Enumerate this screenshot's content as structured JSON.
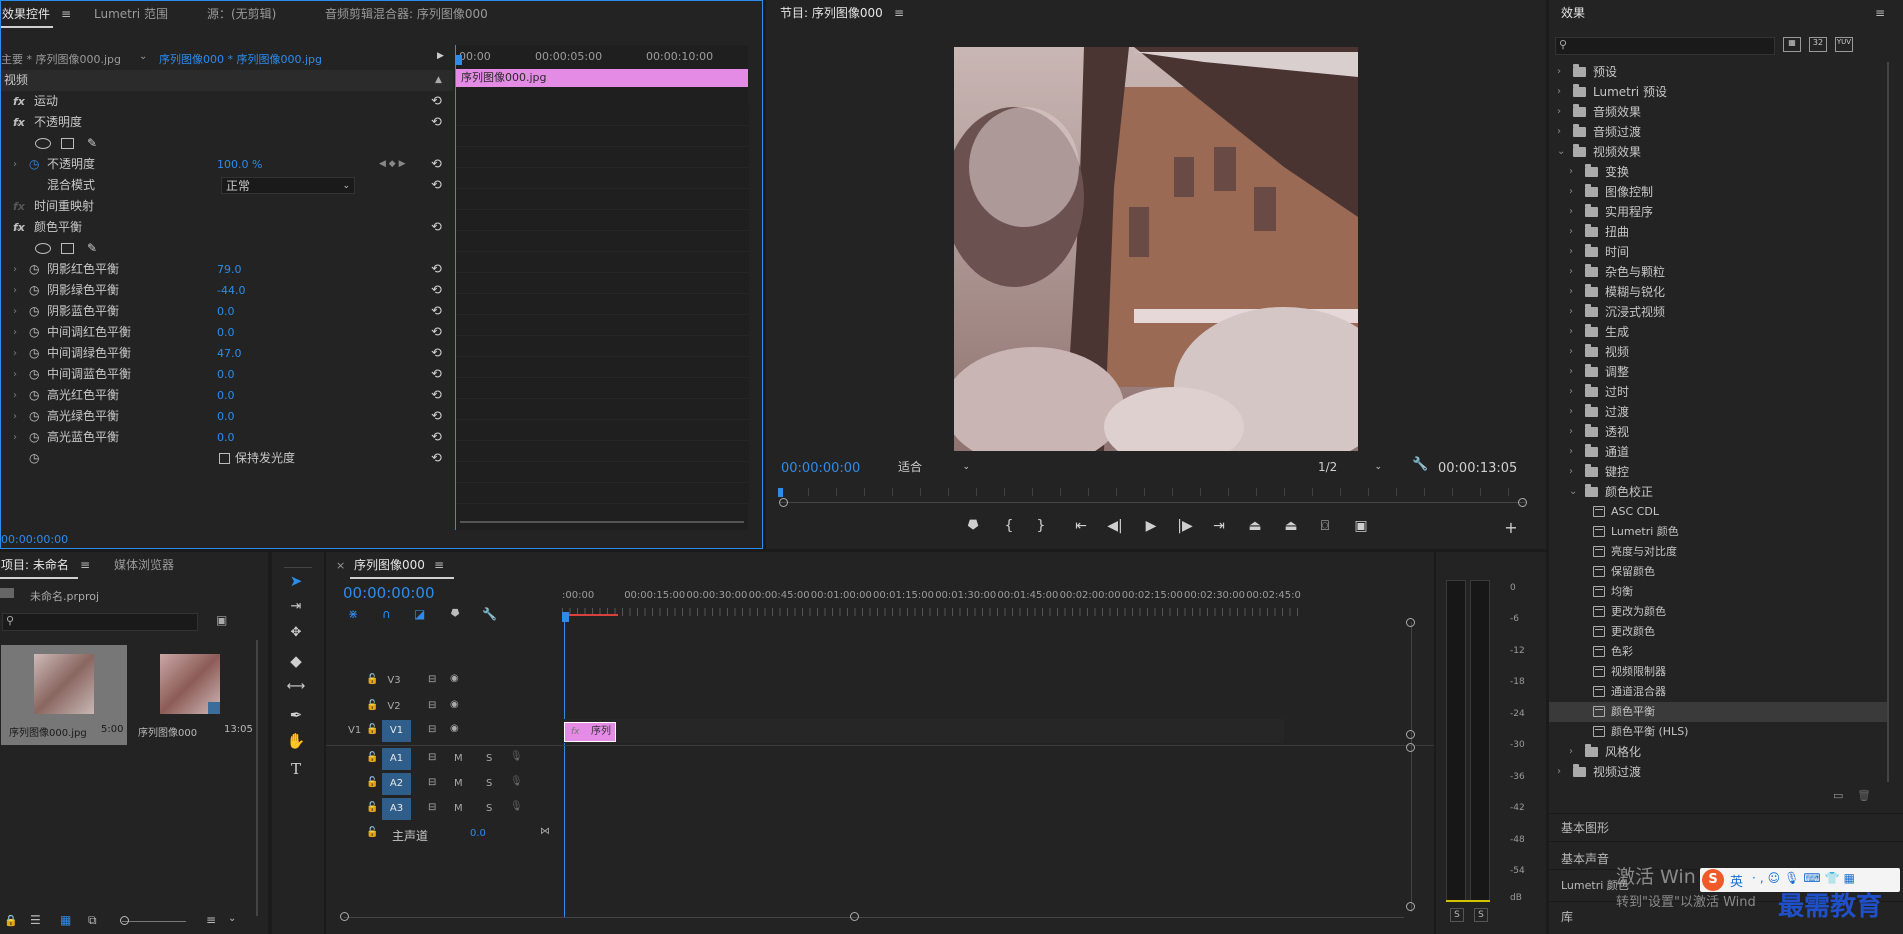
{
  "effect_controls": {
    "tabs": [
      "效果控件",
      "Lumetri 范围",
      "源：(无剪辑)",
      "音频剪辑混合器: 序列图像000"
    ],
    "menu_glyph": "≡",
    "master_label": "主要 * 序列图像000.jpg",
    "clip_label": "序列图像000 * 序列图像000.jpg",
    "section_video": "视频",
    "fx_badge": "fx",
    "mini_timeline": {
      "ticks": [
        "00:00",
        "00:00:05:00",
        "00:00:10:00"
      ],
      "clip_label": "序列图像000.jpg"
    },
    "motion": "运动",
    "opacity": "不透明度",
    "opacity_param": {
      "label": "不透明度",
      "value": "100.0 %"
    },
    "blend_mode": {
      "label": "混合模式",
      "value": "正常"
    },
    "time_remap": "时间重映射",
    "color_balance": "颜色平衡",
    "params": [
      {
        "label": "阴影红色平衡",
        "value": "79.0"
      },
      {
        "label": "阴影绿色平衡",
        "value": "-44.0"
      },
      {
        "label": "阴影蓝色平衡",
        "value": "0.0"
      },
      {
        "label": "中间调红色平衡",
        "value": "0.0"
      },
      {
        "label": "中间调绿色平衡",
        "value": "47.0"
      },
      {
        "label": "中间调蓝色平衡",
        "value": "0.0"
      },
      {
        "label": "高光红色平衡",
        "value": "0.0"
      },
      {
        "label": "高光绿色平衡",
        "value": "0.0"
      },
      {
        "label": "高光蓝色平衡",
        "value": "0.0"
      }
    ],
    "preserve_luminosity": "保持发光度",
    "timecode": "00:00:00:00"
  },
  "program_monitor": {
    "title": "节目: 序列图像000",
    "timecode_current": "00:00:00:00",
    "fit": "适合",
    "resolution": "1/2",
    "timecode_duration": "00:00:13:05"
  },
  "effects_panel": {
    "title": "效果",
    "items": [
      {
        "label": "预设",
        "level": 0,
        "icon": "folder-star-icon",
        "open": false
      },
      {
        "label": "Lumetri 预设",
        "level": 0,
        "icon": "folder-star-icon",
        "open": false
      },
      {
        "label": "音频效果",
        "level": 0,
        "icon": "folder-icon",
        "open": false
      },
      {
        "label": "音频过渡",
        "level": 0,
        "icon": "folder-icon",
        "open": false
      },
      {
        "label": "视频效果",
        "level": 0,
        "icon": "folder-icon",
        "open": true
      },
      {
        "label": "变换",
        "level": 1,
        "icon": "folder-icon",
        "open": false
      },
      {
        "label": "图像控制",
        "level": 1,
        "icon": "folder-icon",
        "open": false
      },
      {
        "label": "实用程序",
        "level": 1,
        "icon": "folder-icon",
        "open": false
      },
      {
        "label": "扭曲",
        "level": 1,
        "icon": "folder-icon",
        "open": false
      },
      {
        "label": "时间",
        "level": 1,
        "icon": "folder-icon",
        "open": false
      },
      {
        "label": "杂色与颗粒",
        "level": 1,
        "icon": "folder-icon",
        "open": false
      },
      {
        "label": "模糊与锐化",
        "level": 1,
        "icon": "folder-icon",
        "open": false
      },
      {
        "label": "沉浸式视频",
        "level": 1,
        "icon": "folder-icon",
        "open": false
      },
      {
        "label": "生成",
        "level": 1,
        "icon": "folder-icon",
        "open": false
      },
      {
        "label": "视频",
        "level": 1,
        "icon": "folder-icon",
        "open": false
      },
      {
        "label": "调整",
        "level": 1,
        "icon": "folder-icon",
        "open": false
      },
      {
        "label": "过时",
        "level": 1,
        "icon": "folder-icon",
        "open": false
      },
      {
        "label": "过渡",
        "level": 1,
        "icon": "folder-icon",
        "open": false
      },
      {
        "label": "透视",
        "level": 1,
        "icon": "folder-icon",
        "open": false
      },
      {
        "label": "通道",
        "level": 1,
        "icon": "folder-icon",
        "open": false
      },
      {
        "label": "键控",
        "level": 1,
        "icon": "folder-icon",
        "open": false
      },
      {
        "label": "颜色校正",
        "level": 1,
        "icon": "folder-icon",
        "open": true
      },
      {
        "label": "ASC CDL",
        "level": 2,
        "icon": "effect-icon"
      },
      {
        "label": "Lumetri 颜色",
        "level": 2,
        "icon": "effect-icon"
      },
      {
        "label": "亮度与对比度",
        "level": 2,
        "icon": "effect-icon"
      },
      {
        "label": "保留颜色",
        "level": 2,
        "icon": "effect-icon"
      },
      {
        "label": "均衡",
        "level": 2,
        "icon": "effect-icon"
      },
      {
        "label": "更改为颜色",
        "level": 2,
        "icon": "effect-icon"
      },
      {
        "label": "更改颜色",
        "level": 2,
        "icon": "effect-icon"
      },
      {
        "label": "色彩",
        "level": 2,
        "icon": "effect-icon"
      },
      {
        "label": "视频限制器",
        "level": 2,
        "icon": "effect-icon"
      },
      {
        "label": "通道混合器",
        "level": 2,
        "icon": "effect-icon"
      },
      {
        "label": "颜色平衡",
        "level": 2,
        "icon": "effect-icon",
        "selected": true
      },
      {
        "label": "颜色平衡 (HLS)",
        "level": 2,
        "icon": "effect-icon"
      },
      {
        "label": "风格化",
        "level": 1,
        "icon": "folder-icon",
        "open": false
      },
      {
        "label": "视频过渡",
        "level": 0,
        "icon": "folder-icon",
        "open": false
      }
    ],
    "bottom_panels": [
      "基本图形",
      "基本声音",
      "Lumetri 颜色",
      "库"
    ]
  },
  "project_panel": {
    "tabs": [
      "项目: 未命名",
      "媒体浏览器"
    ],
    "project_file": "未命名.prproj",
    "items": [
      {
        "name": "序列图像000.jpg",
        "duration": "5:00"
      },
      {
        "name": "序列图像000",
        "duration": "13:05"
      }
    ]
  },
  "timeline": {
    "tab": "序列图像000",
    "close": "×",
    "timecode": "00:00:00:00",
    "ruler": [
      ":00:00",
      "00:00:15:00",
      "00:00:30:00",
      "00:00:45:00",
      "00:01:00:00",
      "00:01:15:00",
      "00:01:30:00",
      "00:01:45:00",
      "00:02:00:00",
      "00:02:15:00",
      "00:02:30:00",
      "00:02:45:0"
    ],
    "video_tracks": [
      "V3",
      "V2",
      "V1"
    ],
    "source_patch": "V1",
    "audio_tracks": [
      "A1",
      "A2",
      "A3"
    ],
    "mute": "M",
    "solo": "S",
    "master": {
      "label": "主声道",
      "value": "0.0"
    },
    "clip": {
      "badge": "fx",
      "label": "序列"
    }
  },
  "audio_meter": {
    "scale": [
      "0",
      "-6",
      "-12",
      "-18",
      "-24",
      "-30",
      "-36",
      "-42",
      "-48",
      "-54",
      "dB"
    ],
    "solo": [
      "S",
      "S"
    ]
  },
  "overlay": {
    "activate_title": "激活 Win",
    "activate_sub": "转到\"设置\"以激活 Wind",
    "ime": "英",
    "watermark": "最需教育"
  },
  "colors": {
    "accent": "#2d8ceb",
    "clip": "#e48be6",
    "panel": "#232323",
    "bg": "#1b1b1b"
  }
}
